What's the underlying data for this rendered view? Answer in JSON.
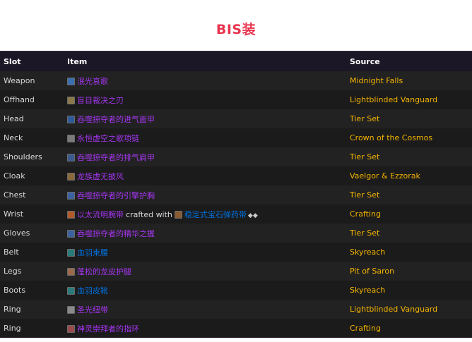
{
  "title": "BIS装",
  "colors": {
    "epic": "#a335ee",
    "rare": "#0070dd",
    "source": "#f4b400",
    "title": "#e8344e"
  },
  "table": {
    "headers": {
      "slot": "Slot",
      "item": "Item",
      "source": "Source"
    },
    "rows": [
      {
        "slot": "Weapon",
        "item": "泯光哀歌",
        "quality": "epic",
        "icon": "staff-icon",
        "icon_color": "#3a6fb0",
        "source": "Midnight Falls"
      },
      {
        "slot": "Offhand",
        "item": "盲目裁决之刃",
        "quality": "epic",
        "icon": "dagger-icon",
        "icon_color": "#8a7a4a",
        "source": "Lightblinded Vanguard"
      },
      {
        "slot": "Head",
        "item": "吞噬掠夺者的进气面甲",
        "quality": "epic",
        "icon": "helm-icon",
        "icon_color": "#2f5a9a",
        "source": "Tier Set"
      },
      {
        "slot": "Neck",
        "item": "永恒虚空之歌项链",
        "quality": "epic",
        "icon": "necklace-icon",
        "icon_color": "#7a7a7a",
        "source": "Crown of the Cosmos"
      },
      {
        "slot": "Shoulders",
        "item": "吞噬掠夺者的排气肩甲",
        "quality": "epic",
        "icon": "shoulder-icon",
        "icon_color": "#3a5a90",
        "source": "Tier Set"
      },
      {
        "slot": "Cloak",
        "item": "龙族虚无披风",
        "quality": "epic",
        "icon": "cloak-icon",
        "icon_color": "#8a6a3a",
        "source": "Vaelgor & Ezzorak"
      },
      {
        "slot": "Chest",
        "item": "吞噬掠夺者的引擎护胸",
        "quality": "epic",
        "icon": "chest-icon",
        "icon_color": "#3a62a0",
        "source": "Tier Set"
      },
      {
        "slot": "Wrist",
        "item": "以太流明腕带",
        "quality": "epic",
        "icon": "bracer-icon",
        "icon_color": "#b05a2a",
        "crafted_text": "crafted with",
        "reagent": "稳定式宝石弹药带",
        "reagent_quality": "rare",
        "reagent_icon": "ammo-belt-icon",
        "reagent_icon_color": "#8a5a30",
        "gems": "◆◆",
        "source": "Crafting"
      },
      {
        "slot": "Gloves",
        "item": "吞噬掠夺者的精华之握",
        "quality": "epic",
        "icon": "gloves-icon",
        "icon_color": "#3a62a0",
        "source": "Tier Set"
      },
      {
        "slot": "Belt",
        "item": "血羽束腰",
        "quality": "rare",
        "icon": "belt-icon",
        "icon_color": "#2a7a7a",
        "source": "Skyreach"
      },
      {
        "slot": "Legs",
        "item": "蓬松的龙皮护腿",
        "quality": "epic",
        "icon": "legs-icon",
        "icon_color": "#9a6a4a",
        "source": "Pit of Saron"
      },
      {
        "slot": "Boots",
        "item": "血羽皮靴",
        "quality": "rare",
        "icon": "boots-icon",
        "icon_color": "#2a7a7a",
        "source": "Skyreach"
      },
      {
        "slot": "Ring",
        "item": "圣光纽带",
        "quality": "epic",
        "icon": "ring-icon",
        "icon_color": "#8a8a8a",
        "source": "Lightblinded Vanguard"
      },
      {
        "slot": "Ring",
        "item": "神灵崇拜者的指环",
        "quality": "epic",
        "icon": "ring-icon",
        "icon_color": "#9a4a4a",
        "source": "Crafting"
      }
    ]
  }
}
